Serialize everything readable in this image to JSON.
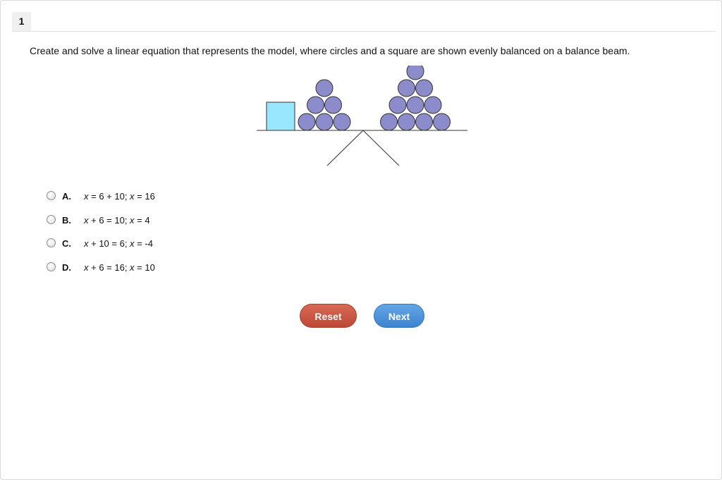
{
  "question": {
    "number": "1",
    "prompt": "Create and solve a linear equation that represents the model, where circles and a square are shown evenly balanced on a balance beam."
  },
  "balance_model": {
    "left_pan": {
      "squares": 1,
      "circles": 6
    },
    "right_pan": {
      "circles": 10
    },
    "colors": {
      "square_fill": "#99e6ff",
      "circle_fill": "#8c8ccc",
      "outline": "#333333"
    }
  },
  "choices": [
    {
      "letter": "A.",
      "parts": [
        [
          "x",
          true
        ],
        [
          " = 6 + 10; ",
          false
        ],
        [
          "x",
          true
        ],
        [
          " = 16",
          false
        ]
      ]
    },
    {
      "letter": "B.",
      "parts": [
        [
          "x",
          true
        ],
        [
          " + 6 = 10; ",
          false
        ],
        [
          "x",
          true
        ],
        [
          " = 4",
          false
        ]
      ]
    },
    {
      "letter": "C.",
      "parts": [
        [
          "x",
          true
        ],
        [
          " + 10 = 6; ",
          false
        ],
        [
          "x",
          true
        ],
        [
          " = -4",
          false
        ]
      ]
    },
    {
      "letter": "D.",
      "parts": [
        [
          "x",
          true
        ],
        [
          " + 6 = 16; ",
          false
        ],
        [
          "x",
          true
        ],
        [
          " = 10",
          false
        ]
      ]
    }
  ],
  "buttons": {
    "reset_label": "Reset",
    "next_label": "Next",
    "reset_color": "#c9503d",
    "next_color": "#4a90db"
  }
}
